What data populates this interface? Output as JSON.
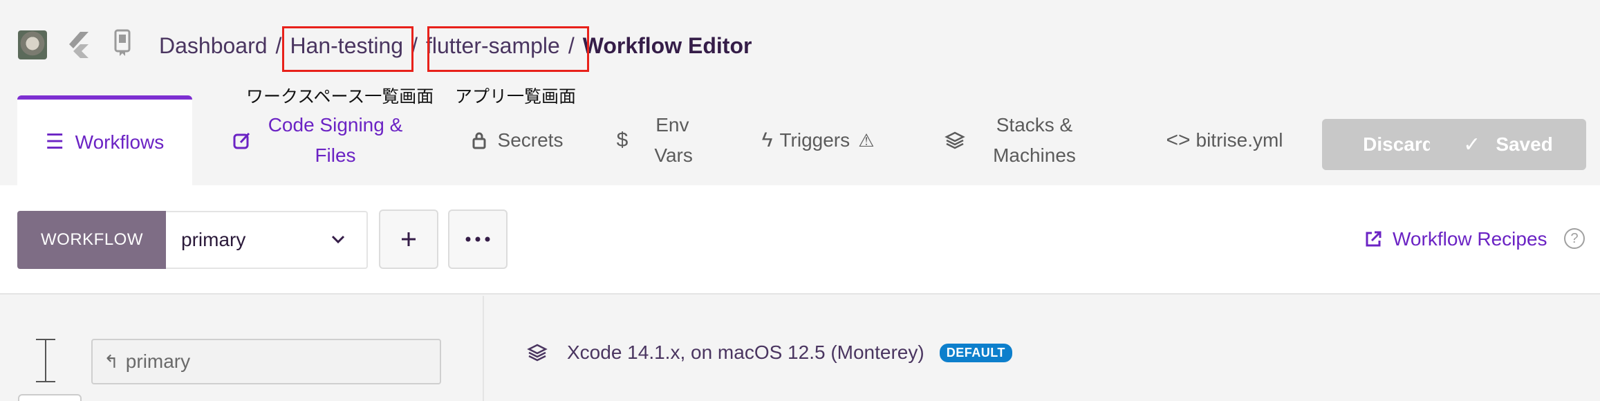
{
  "breadcrumb": {
    "items": [
      "Dashboard",
      "Han-testing",
      "flutter-sample"
    ],
    "separator": "/",
    "current": "Workflow Editor"
  },
  "annotations": {
    "workspace_list": "ワークスペース一覧画面",
    "app_list": "アプリ一覧画面"
  },
  "tabs": [
    {
      "label": "Workflows",
      "icon": "list-icon",
      "active": true
    },
    {
      "label": "Code Signing & Files",
      "icon": "edit-square-icon",
      "active": false
    },
    {
      "label": "Secrets",
      "icon": "lock-icon",
      "active": false
    },
    {
      "label": "Env Vars",
      "icon": "dollar-icon",
      "active": false
    },
    {
      "label": "Triggers",
      "icon": "lightning-icon",
      "active": false,
      "warning": true
    },
    {
      "label": "Stacks & Machines",
      "icon": "layers-icon",
      "active": false
    },
    {
      "label": "bitrise.yml",
      "icon": "code-icon",
      "active": false
    }
  ],
  "actions": {
    "discard_label": "Discard",
    "saved_label": "Saved"
  },
  "toolbar": {
    "workflow_label": "WORKFLOW",
    "selected_workflow": "primary",
    "recipes_label": "Workflow Recipes"
  },
  "left_pane": {
    "trigger_value": "primary"
  },
  "right_pane": {
    "stack_name": "Xcode 14.1.x, on macOS 12.5 (Monterey)",
    "stack_badge": "DEFAULT"
  },
  "colors": {
    "accent": "#6b23c4",
    "highlight_box": "#e8211a",
    "badge": "#0d7fcc",
    "workflow_label_bg": "#7e6d85"
  }
}
